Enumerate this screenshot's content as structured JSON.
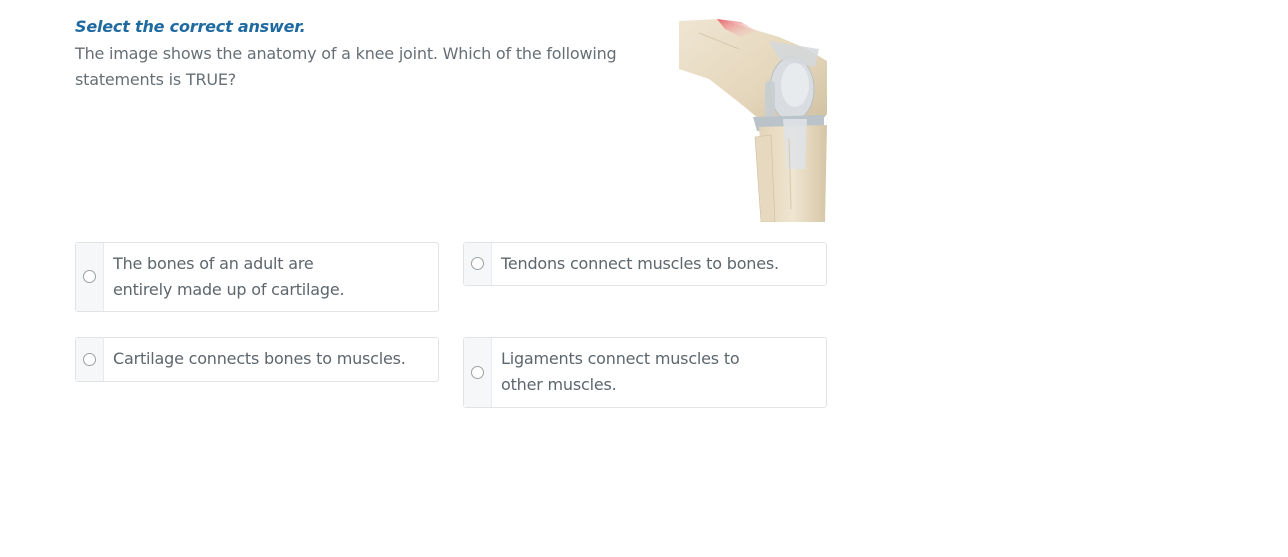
{
  "question": {
    "instruction": "Select the correct answer.",
    "prompt": "The image shows the anatomy of a knee joint. Which of the following statements is TRUE?",
    "figure_icon": "knee-joint-anatomy-illustration"
  },
  "options": [
    {
      "label": "The bones of an adult are entirely made up of cartilage."
    },
    {
      "label": "Tendons connect muscles to bones."
    },
    {
      "label": "Cartilage connects bones to muscles."
    },
    {
      "label": "Ligaments connect muscles to other muscles."
    }
  ],
  "colors": {
    "instruction": "#1f6aa0",
    "body_text": "#666f76",
    "option_border": "#e1e3e5"
  }
}
